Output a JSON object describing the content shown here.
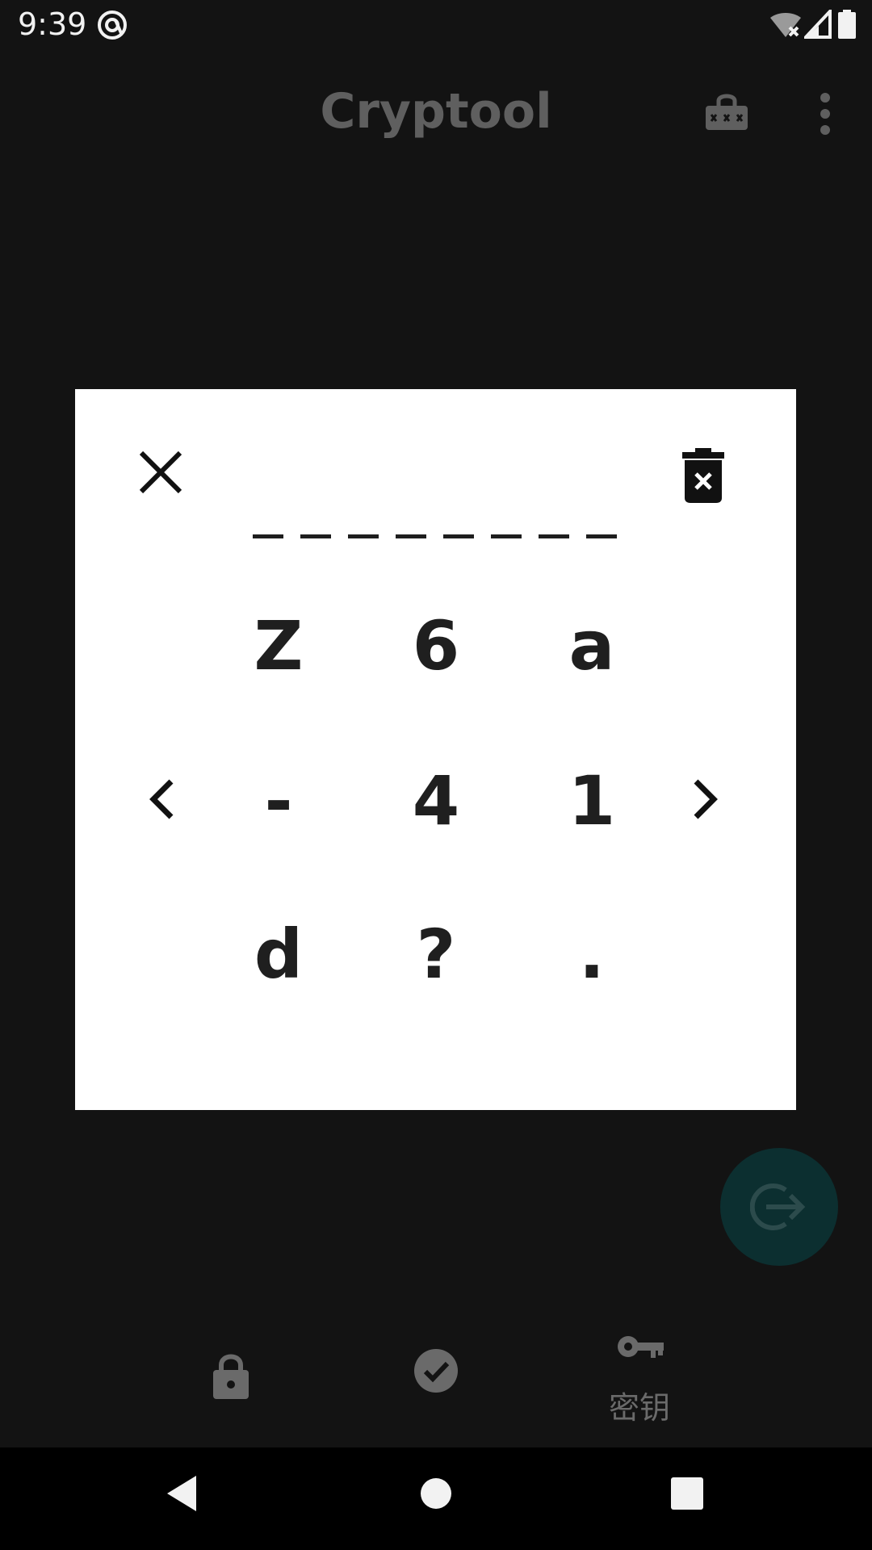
{
  "status_bar": {
    "time": "9:39",
    "icons": [
      "at-sign-icon",
      "wifi-off-icon",
      "signal-icon",
      "battery-icon"
    ]
  },
  "app_bar": {
    "title": "Cryptool",
    "actions": [
      "lock-password-icon",
      "more-vert-icon"
    ]
  },
  "dialog": {
    "pin_length": 8,
    "keypad": {
      "row1": [
        "Z",
        "6",
        "a"
      ],
      "row2": [
        "-",
        "4",
        "1"
      ],
      "row3": [
        "d",
        "?",
        "."
      ]
    },
    "icons": [
      "close-icon",
      "delete-forever-icon",
      "chevron-left-icon",
      "chevron-right-icon"
    ]
  },
  "fab": {
    "icon": "logout-icon"
  },
  "bottom_nav": {
    "items": [
      {
        "icon": "lock-icon",
        "label": ""
      },
      {
        "icon": "check-circle-icon",
        "label": ""
      },
      {
        "icon": "key-icon",
        "label": "密钥"
      }
    ]
  },
  "system_nav": {
    "buttons": [
      "back-icon",
      "home-icon",
      "recents-icon"
    ]
  },
  "colors": {
    "background": "#131313",
    "dialog": "#ffffff",
    "fab": "#0c2f30",
    "muted": "#6a6a6a"
  }
}
